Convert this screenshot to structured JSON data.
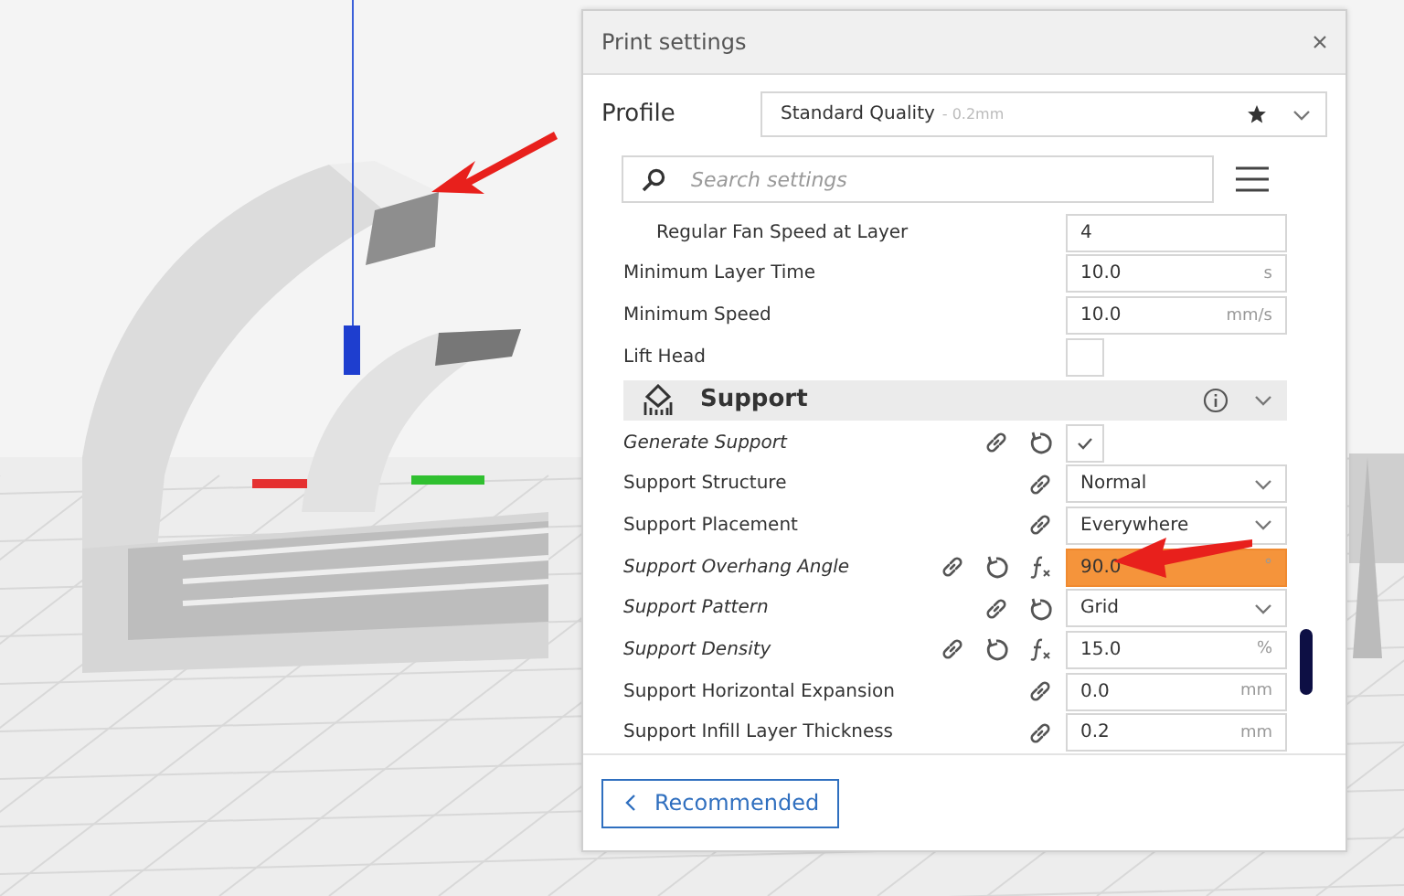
{
  "window": {
    "title": "Print settings"
  },
  "profile": {
    "label": "Profile",
    "value": "Standard Quality",
    "detail": "- 0.2mm",
    "favorite": true
  },
  "search": {
    "placeholder": "Search settings"
  },
  "settings": [
    {
      "kind": "continued",
      "children": [
        {
          "kind": "number",
          "label": "Regular Fan Speed at Layer",
          "modified": false,
          "value": "4",
          "highlighted": false
        }
      ]
    },
    {
      "kind": "number",
      "label": "Minimum Layer Time",
      "modified": false,
      "value": "10.0",
      "unit": "s",
      "highlighted": false
    },
    {
      "kind": "number",
      "label": "Minimum Speed",
      "modified": false,
      "value": "10.0",
      "unit": "mm/s",
      "highlighted": false
    },
    {
      "kind": "checkbox",
      "label": "Lift Head",
      "modified": false,
      "checked": false
    },
    {
      "kind": "section",
      "label": "Support",
      "expanded": true
    },
    {
      "kind": "checkbox",
      "label": "Generate Support",
      "modified": true,
      "linked": true,
      "resettable": true,
      "checked": true
    },
    {
      "kind": "dropdown",
      "label": "Support Structure",
      "modified": false,
      "linked": true,
      "value": "Normal"
    },
    {
      "kind": "dropdown",
      "label": "Support Placement",
      "modified": false,
      "linked": true,
      "value": "Everywhere"
    },
    {
      "kind": "number",
      "label": "Support Overhang Angle",
      "modified": true,
      "linked": true,
      "resettable": true,
      "formula": true,
      "value": "90.0",
      "unit": "°",
      "highlighted": true
    },
    {
      "kind": "dropdown",
      "label": "Support Pattern",
      "modified": true,
      "linked": true,
      "resettable": true,
      "value": "Grid"
    },
    {
      "kind": "number",
      "label": "Support Density",
      "modified": true,
      "linked": true,
      "resettable": true,
      "formula": true,
      "value": "15.0",
      "unit": "%",
      "highlighted": false
    },
    {
      "kind": "number",
      "label": "Support Horizontal Expansion",
      "modified": false,
      "linked": true,
      "value": "0.0",
      "unit": "mm",
      "highlighted": false
    },
    {
      "kind": "number",
      "label": "Support Infill Layer Thickness",
      "modified": false,
      "linked": true,
      "value": "0.2",
      "unit": "mm",
      "highlighted": false
    }
  ],
  "footer": {
    "button": "Recommended"
  }
}
